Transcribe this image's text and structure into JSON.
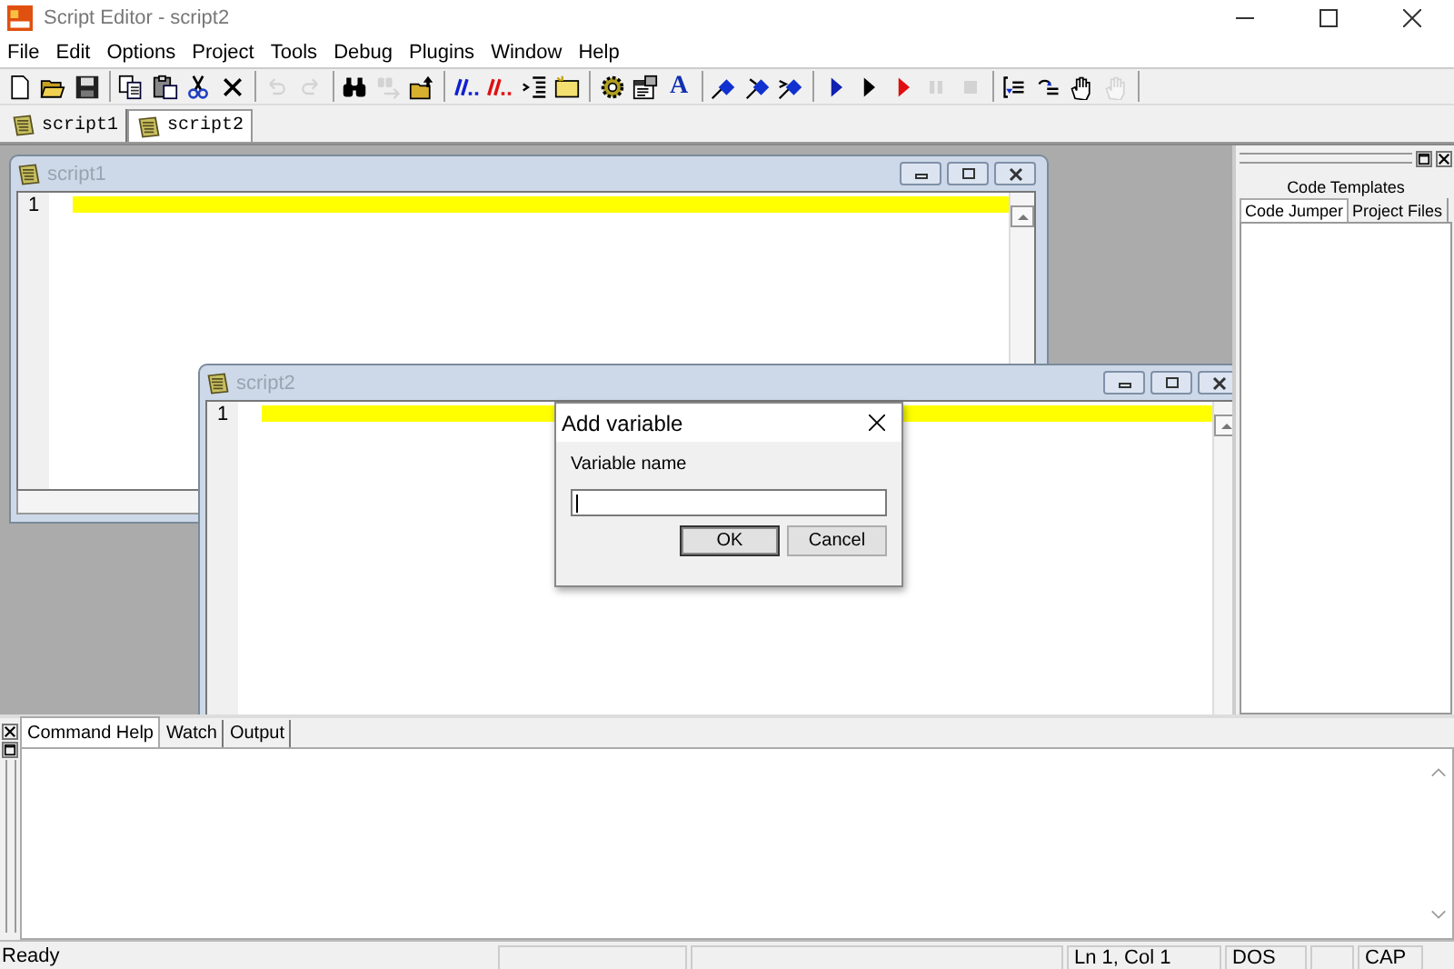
{
  "window": {
    "title": "Script Editor - script2"
  },
  "menu": [
    "File",
    "Edit",
    "Options",
    "Project",
    "Tools",
    "Debug",
    "Plugins",
    "Window",
    "Help"
  ],
  "toolbar": [
    [
      {
        "kind": "new",
        "disabled": false
      },
      {
        "kind": "open",
        "disabled": false
      },
      {
        "kind": "save",
        "disabled": false
      }
    ],
    [
      {
        "kind": "copy",
        "disabled": false
      },
      {
        "kind": "paste",
        "disabled": false
      },
      {
        "kind": "cut",
        "disabled": false
      },
      {
        "kind": "delete",
        "disabled": false
      }
    ],
    [
      {
        "kind": "undo",
        "disabled": true
      },
      {
        "kind": "redo",
        "disabled": true
      }
    ],
    [
      {
        "kind": "find",
        "disabled": false
      },
      {
        "kind": "findnext",
        "disabled": true
      },
      {
        "kind": "browse",
        "disabled": false
      }
    ],
    [
      {
        "kind": "comment",
        "disabled": false
      },
      {
        "kind": "uncomment",
        "disabled": false
      },
      {
        "kind": "indent",
        "disabled": false
      },
      {
        "kind": "note",
        "disabled": false
      }
    ],
    [
      {
        "kind": "gear",
        "disabled": false
      },
      {
        "kind": "properties",
        "disabled": false
      },
      {
        "kind": "font",
        "disabled": false,
        "glyph": "A"
      }
    ],
    [
      {
        "kind": "bookmark",
        "disabled": false
      },
      {
        "kind": "bookmarknext",
        "disabled": false
      },
      {
        "kind": "bookmarkprev",
        "disabled": false
      }
    ],
    [
      {
        "kind": "run",
        "disabled": false
      },
      {
        "kind": "runplain",
        "disabled": false
      },
      {
        "kind": "runred",
        "disabled": false
      },
      {
        "kind": "pause",
        "disabled": true
      },
      {
        "kind": "stop",
        "disabled": true
      }
    ],
    [
      {
        "kind": "stepinto",
        "disabled": false
      },
      {
        "kind": "stepover",
        "disabled": false
      },
      {
        "kind": "hand",
        "disabled": false
      },
      {
        "kind": "hand",
        "disabled": true
      }
    ]
  ],
  "document_tabs": [
    {
      "label": "script1",
      "selected": false
    },
    {
      "label": "script2",
      "selected": true
    }
  ],
  "editor_windows": [
    {
      "title": "script1",
      "line_numbers": [
        "1"
      ]
    },
    {
      "title": "script2",
      "line_numbers": [
        "1"
      ]
    }
  ],
  "side_panel": {
    "tabs": [
      {
        "label": "Code Templates",
        "selected": false
      },
      {
        "label": "Code Jumper",
        "selected": true
      },
      {
        "label": "Project Files",
        "selected": false
      }
    ]
  },
  "dialog": {
    "title": "Add variable",
    "label": "Variable name",
    "buttons": [
      "OK",
      "Cancel"
    ]
  },
  "bottom_panel": {
    "tabs": [
      {
        "label": "Command Help",
        "selected": true
      },
      {
        "label": "Watch",
        "selected": false
      },
      {
        "label": "Output",
        "selected": false
      }
    ]
  },
  "status_bar": {
    "message": "Ready",
    "position": "Ln 1, Col 1",
    "line_ending": "DOS",
    "caps": "CAP"
  }
}
